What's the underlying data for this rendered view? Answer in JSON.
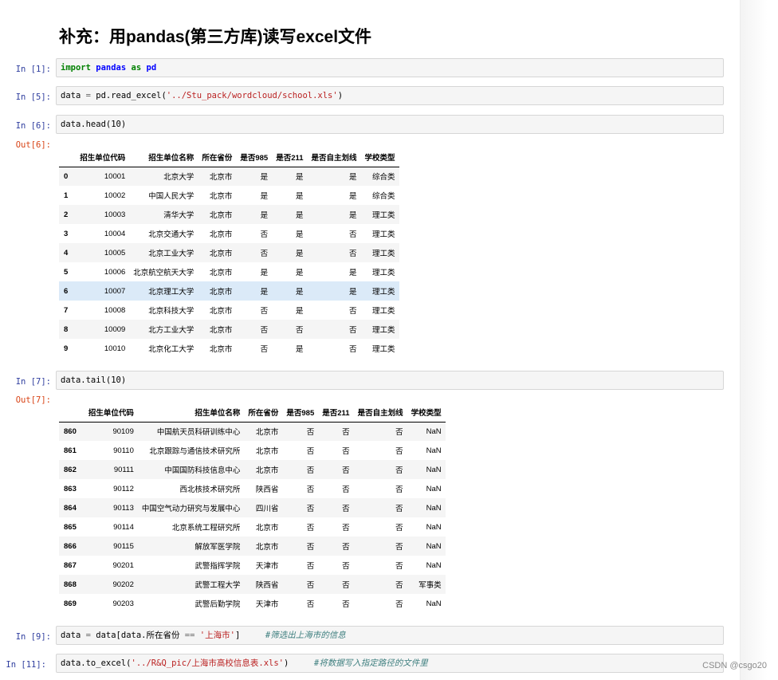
{
  "title": "补充：用pandas(第三方库)读写excel文件",
  "cells": [
    {
      "prompt": "In  [1]:",
      "tokens": [
        {
          "t": "import",
          "c": "kw"
        },
        {
          "t": " "
        },
        {
          "t": "pandas",
          "c": "nm"
        },
        {
          "t": " "
        },
        {
          "t": "as",
          "c": "kw"
        },
        {
          "t": " "
        },
        {
          "t": "pd",
          "c": "nm"
        }
      ]
    },
    {
      "prompt": "In  [5]:",
      "tokens": [
        {
          "t": "data "
        },
        {
          "t": "=",
          "c": "op"
        },
        {
          "t": " pd.read_excel("
        },
        {
          "t": "'../Stu_pack/wordcloud/school.xls'",
          "c": "str"
        },
        {
          "t": ")"
        }
      ]
    },
    {
      "prompt": "In  [6]:",
      "out_prompt": "Out[6]:",
      "tokens": [
        {
          "t": "data.head(10)"
        }
      ]
    },
    {
      "prompt": "In  [7]:",
      "out_prompt": "Out[7]:",
      "tokens": [
        {
          "t": "data.tail(10)"
        }
      ]
    },
    {
      "prompt": "In  [9]:",
      "tokens": [
        {
          "t": "data "
        },
        {
          "t": "=",
          "c": "op"
        },
        {
          "t": " data[data.所在省份 "
        },
        {
          "t": "==",
          "c": "op"
        },
        {
          "t": " "
        },
        {
          "t": "'上海市'",
          "c": "str"
        },
        {
          "t": "]     "
        },
        {
          "t": "#筛选出上海市的信息",
          "c": "cm"
        }
      ]
    },
    {
      "prompt": "In  [11]:",
      "tokens": [
        {
          "t": "data.to_excel("
        },
        {
          "t": "'../R&Q_pic/上海市高校信息表.xls'",
          "c": "str"
        },
        {
          "t": ")     "
        },
        {
          "t": "#将数据写入指定路径的文件里",
          "c": "cm"
        }
      ]
    }
  ],
  "head_table": {
    "columns": [
      "",
      "招生单位代码",
      "招生单位名称",
      "所在省份",
      "是否985",
      "是否211",
      "是否自主划线",
      "学校类型"
    ],
    "highlight_row_index": 6,
    "rows": [
      [
        "0",
        "10001",
        "北京大学",
        "北京市",
        "是",
        "是",
        "是",
        "综合类"
      ],
      [
        "1",
        "10002",
        "中国人民大学",
        "北京市",
        "是",
        "是",
        "是",
        "综合类"
      ],
      [
        "2",
        "10003",
        "清华大学",
        "北京市",
        "是",
        "是",
        "是",
        "理工类"
      ],
      [
        "3",
        "10004",
        "北京交通大学",
        "北京市",
        "否",
        "是",
        "否",
        "理工类"
      ],
      [
        "4",
        "10005",
        "北京工业大学",
        "北京市",
        "否",
        "是",
        "否",
        "理工类"
      ],
      [
        "5",
        "10006",
        "北京航空航天大学",
        "北京市",
        "是",
        "是",
        "是",
        "理工类"
      ],
      [
        "6",
        "10007",
        "北京理工大学",
        "北京市",
        "是",
        "是",
        "是",
        "理工类"
      ],
      [
        "7",
        "10008",
        "北京科技大学",
        "北京市",
        "否",
        "是",
        "否",
        "理工类"
      ],
      [
        "8",
        "10009",
        "北方工业大学",
        "北京市",
        "否",
        "否",
        "否",
        "理工类"
      ],
      [
        "9",
        "10010",
        "北京化工大学",
        "北京市",
        "否",
        "是",
        "否",
        "理工类"
      ]
    ]
  },
  "tail_table": {
    "columns": [
      "",
      "招生单位代码",
      "招生单位名称",
      "所在省份",
      "是否985",
      "是否211",
      "是否自主划线",
      "学校类型"
    ],
    "rows": [
      [
        "860",
        "90109",
        "中国航天员科研训练中心",
        "北京市",
        "否",
        "否",
        "否",
        "NaN"
      ],
      [
        "861",
        "90110",
        "北京跟踪与通信技术研究所",
        "北京市",
        "否",
        "否",
        "否",
        "NaN"
      ],
      [
        "862",
        "90111",
        "中国国防科技信息中心",
        "北京市",
        "否",
        "否",
        "否",
        "NaN"
      ],
      [
        "863",
        "90112",
        "西北核技术研究所",
        "陕西省",
        "否",
        "否",
        "否",
        "NaN"
      ],
      [
        "864",
        "90113",
        "中国空气动力研究与发展中心",
        "四川省",
        "否",
        "否",
        "否",
        "NaN"
      ],
      [
        "865",
        "90114",
        "北京系统工程研究所",
        "北京市",
        "否",
        "否",
        "否",
        "NaN"
      ],
      [
        "866",
        "90115",
        "解放军医学院",
        "北京市",
        "否",
        "否",
        "否",
        "NaN"
      ],
      [
        "867",
        "90201",
        "武警指挥学院",
        "天津市",
        "否",
        "否",
        "否",
        "NaN"
      ],
      [
        "868",
        "90202",
        "武警工程大学",
        "陕西省",
        "否",
        "否",
        "否",
        "军事类"
      ],
      [
        "869",
        "90203",
        "武警后勤学院",
        "天津市",
        "否",
        "否",
        "否",
        "NaN"
      ]
    ]
  },
  "watermark": "CSDN @csgo20"
}
